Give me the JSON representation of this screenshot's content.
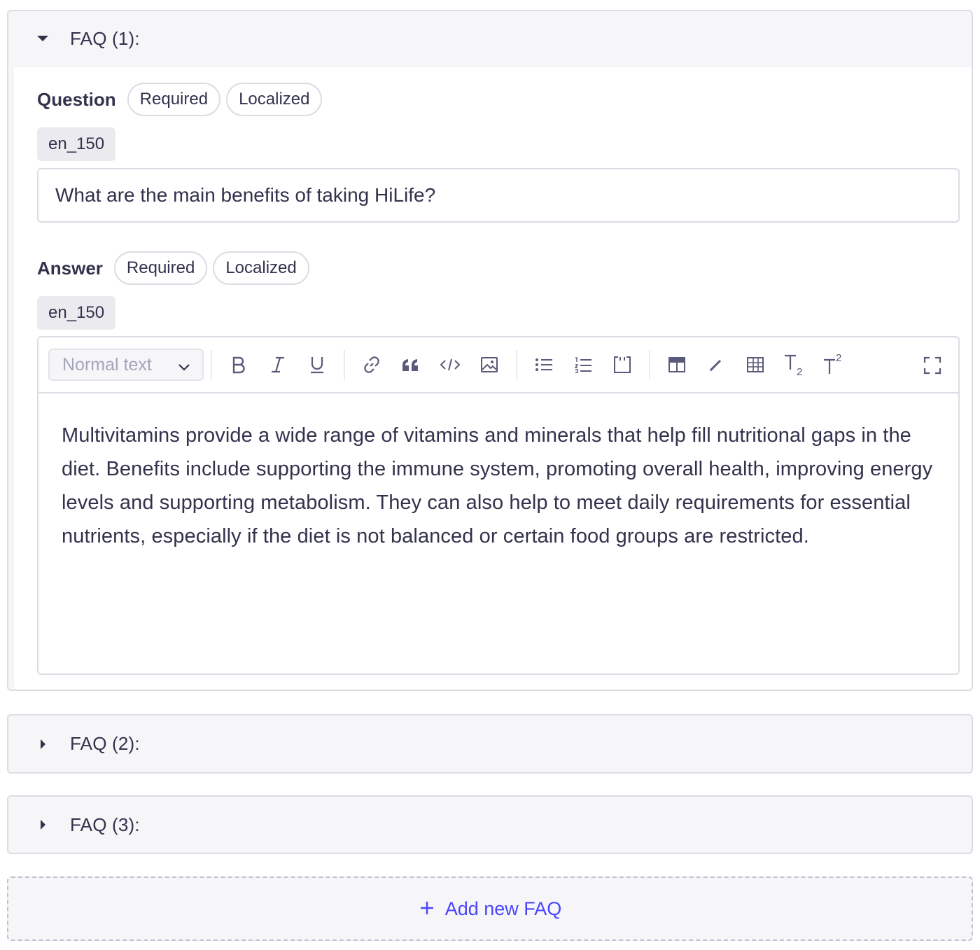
{
  "faqs": [
    {
      "title": "FAQ (1):",
      "expanded": true,
      "question": {
        "label": "Question",
        "badges": [
          "Required",
          "Localized"
        ],
        "locale": "en_150",
        "value": "What are the main benefits of taking HiLife?"
      },
      "answer": {
        "label": "Answer",
        "badges": [
          "Required",
          "Localized"
        ],
        "locale": "en_150",
        "toolbar": {
          "block_type": "Normal text",
          "buttons": [
            "bold-icon",
            "italic-icon",
            "underline-icon",
            "link-icon",
            "quote-icon",
            "code-icon",
            "image-icon",
            "bullet-list-icon",
            "numbered-list-icon",
            "code-block-icon",
            "layout-icon",
            "highlight-icon",
            "table-icon",
            "subscript-icon",
            "superscript-icon",
            "fullscreen-icon"
          ]
        },
        "value": "Multivitamins provide a wide range of vitamins and minerals that help fill nutritional gaps in the diet. Benefits include supporting the immune system, promoting overall health, improving energy levels and supporting metabolism. They can also help to meet daily requirements for essential nutrients, especially if the diet is not balanced or certain food groups are restricted."
      }
    },
    {
      "title": "FAQ (2):",
      "expanded": false
    },
    {
      "title": "FAQ (3):",
      "expanded": false
    }
  ],
  "add_button": {
    "label": "Add new FAQ"
  },
  "colors": {
    "accent": "#4945ff",
    "border": "#dcdce4",
    "panel_bg": "#f6f6f9",
    "text": "#32324d"
  }
}
